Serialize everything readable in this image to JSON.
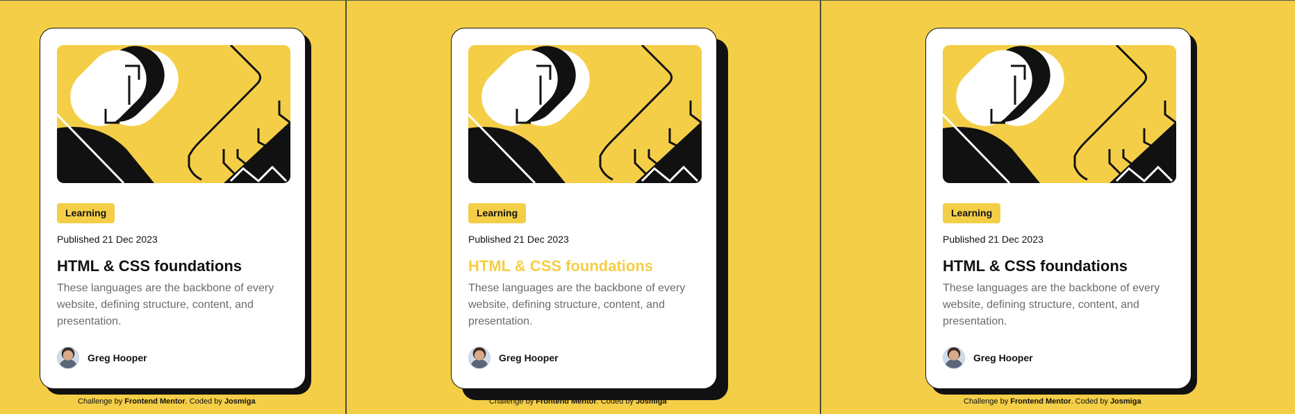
{
  "colors": {
    "accent": "#f4ce47",
    "ink": "#111111",
    "muted": "#6b6b6b",
    "card": "#ffffff"
  },
  "card": {
    "tag": "Learning",
    "published": "Published 21 Dec 2023",
    "title": "HTML & CSS foundations",
    "description": "These languages are the backbone of every website, defining structure, content, and presentation.",
    "author": "Greg Hooper",
    "avatar_icon": "avatar-photo",
    "hero_icon": "abstract-illustration"
  },
  "attribution": {
    "prefix": "Challenge by ",
    "challenge_link": "Frontend Mentor",
    "middle": ". Coded by ",
    "coder_link": "Josmiga"
  }
}
